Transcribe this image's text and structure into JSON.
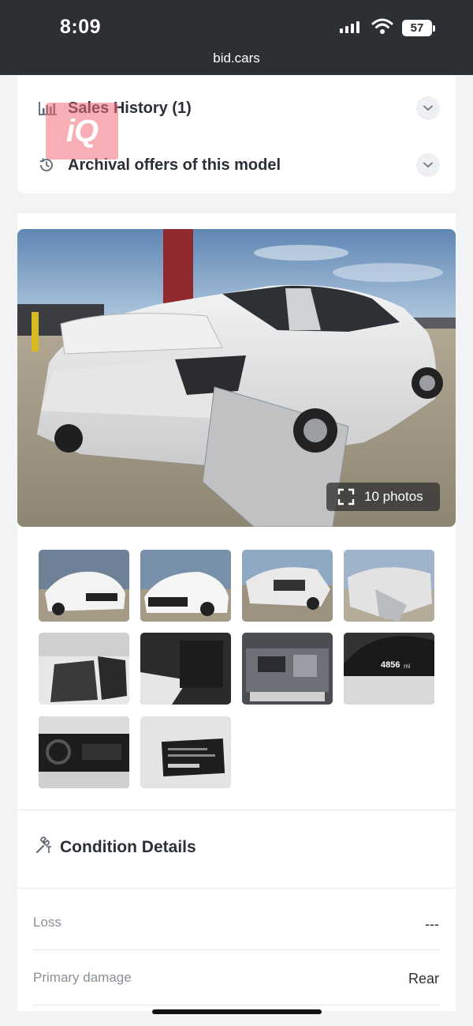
{
  "status_bar": {
    "time": "8:09",
    "battery": "57"
  },
  "browser": {
    "url": "bid.cars"
  },
  "accordion": {
    "items": [
      {
        "label": "Sales History (1)",
        "icon": "bar-chart-icon"
      },
      {
        "label": "Archival offers of this model",
        "icon": "history-icon"
      }
    ]
  },
  "watermark": {
    "text": "iQ"
  },
  "gallery": {
    "photo_count": "10 photos",
    "thumbnails": [
      {
        "subject": "front-left exterior"
      },
      {
        "subject": "front exterior"
      },
      {
        "subject": "rear damage side view"
      },
      {
        "subject": "rear damage close"
      },
      {
        "subject": "front interior seats"
      },
      {
        "subject": "rear seats"
      },
      {
        "subject": "engine bay"
      },
      {
        "subject": "odometer",
        "text": "4856",
        "unit": "mi"
      },
      {
        "subject": "dashboard"
      },
      {
        "subject": "vin label"
      }
    ]
  },
  "condition": {
    "title": "Condition Details",
    "rows": [
      {
        "label": "Loss",
        "value": "---"
      },
      {
        "label": "Primary damage",
        "value": "Rear"
      }
    ]
  },
  "colors": {
    "topbar": "#2c2f33",
    "page_bg": "#f2f3f5",
    "card_bg": "#ffffff"
  }
}
